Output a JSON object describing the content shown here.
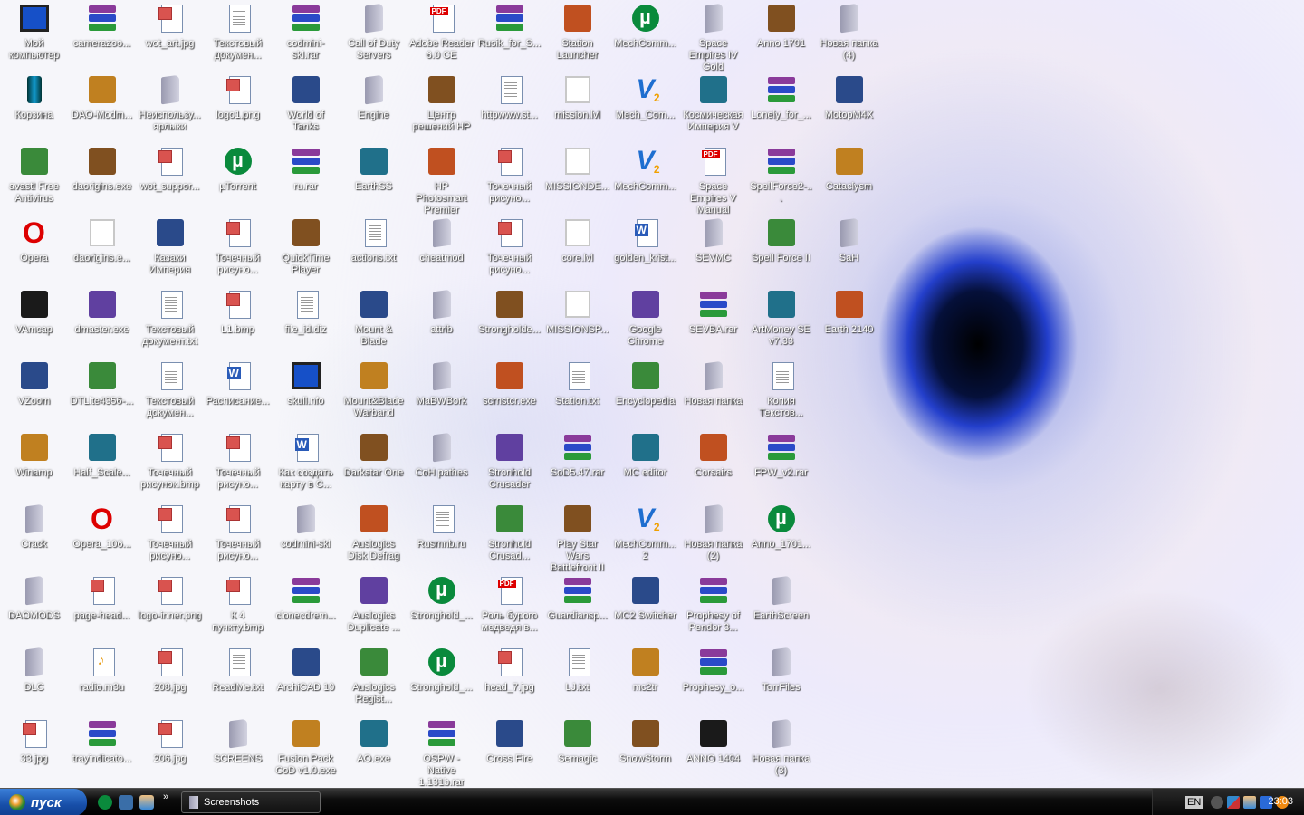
{
  "desktop": {
    "rows": [
      [
        [
          "Мой компьютер",
          "monitor"
        ],
        [
          "camerazoo...",
          "rar"
        ],
        [
          "wot_art.jpg",
          "img"
        ],
        [
          "Текстовый докумен...",
          "txt"
        ],
        [
          "codmini-skl.rar",
          "rar"
        ],
        [
          "Call of Duty Servers",
          "folder"
        ],
        [
          "Adobe Reader 6.0 CE",
          "pdf"
        ],
        [
          "Rusik_for_S...",
          "rar"
        ],
        [
          "Station Launcher",
          "app"
        ],
        [
          "MechComm...",
          "torrent"
        ],
        [
          "Space Empires IV Gold",
          "folder"
        ],
        [
          "Anno 1701",
          "app"
        ],
        [
          "Новая папка (4)",
          "folder"
        ]
      ],
      [
        [
          "Корзина",
          "recycle"
        ],
        [
          "DAO-Modm...",
          "app"
        ],
        [
          "Неиспользу... ярлыки",
          "folder"
        ],
        [
          "logo1.png",
          "img"
        ],
        [
          "World of Tanks",
          "app"
        ],
        [
          "Engine",
          "folder"
        ],
        [
          "Центр решений HP",
          "app"
        ],
        [
          "httpwww.st...",
          "txt"
        ],
        [
          "mission.lvl",
          "blank"
        ],
        [
          "Mech_Com...",
          "mech"
        ],
        [
          "Космическая Империя V",
          "app"
        ],
        [
          "Lonely_for_...",
          "rar"
        ],
        [
          "MotopM4X",
          "app"
        ]
      ],
      [
        [
          "avast! Free Antivirus",
          "app"
        ],
        [
          "daorigins.exe",
          "app"
        ],
        [
          "wot_suppor...",
          "img"
        ],
        [
          "µTorrent",
          "torrent"
        ],
        [
          "ru.rar",
          "rar"
        ],
        [
          "EarthSS",
          "app"
        ],
        [
          "HP Photosmart Premier",
          "app"
        ],
        [
          "Точечный рисуно...",
          "img"
        ],
        [
          "MISSIONDE...",
          "blank"
        ],
        [
          "MechComm...",
          "mech"
        ],
        [
          "Space Empires V Manual",
          "pdf"
        ],
        [
          "SpellForce2-...",
          "rar"
        ],
        [
          "Cataclysm",
          "app"
        ]
      ],
      [
        [
          "Opera",
          "opera"
        ],
        [
          "daorigins.e...",
          "blank"
        ],
        [
          "Казаки Империя",
          "app"
        ],
        [
          "Точечный рисуно...",
          "img"
        ],
        [
          "QuickTime Player",
          "app"
        ],
        [
          "actions.txt",
          "txt"
        ],
        [
          "cheatmod",
          "folder"
        ],
        [
          "Точечный рисуно...",
          "img"
        ],
        [
          "core.lvl",
          "blank"
        ],
        [
          "golden_krist...",
          "doc"
        ],
        [
          "SEVMC",
          "folder"
        ],
        [
          "Spell Force II",
          "app"
        ],
        [
          "SaH",
          "folder"
        ]
      ],
      [
        [
          "VAmcap",
          "app"
        ],
        [
          "dmaster.exe",
          "app"
        ],
        [
          "Текстовый документ.txt",
          "txt"
        ],
        [
          "L1.bmp",
          "img"
        ],
        [
          "file_id.diz",
          "txt"
        ],
        [
          "Mount & Blade",
          "app"
        ],
        [
          "attrib",
          "folder"
        ],
        [
          "Strongholde...",
          "app"
        ],
        [
          "MISSIONSP...",
          "blank"
        ],
        [
          "Google Chrome",
          "app"
        ],
        [
          "SEVBA.rar",
          "rar"
        ],
        [
          "ArtMoney SE v7.33",
          "app"
        ],
        [
          "Earth 2140",
          "app"
        ]
      ],
      [
        [
          "VZoom",
          "app"
        ],
        [
          "DTLite4356-...",
          "app"
        ],
        [
          "Текстовый докумен...",
          "txt"
        ],
        [
          "Расписание...",
          "doc"
        ],
        [
          "skull.nfo",
          "monitor"
        ],
        [
          "Mount&Blade Warband",
          "app"
        ],
        [
          "MaBWBork",
          "folder"
        ],
        [
          "scrnstcr.exe",
          "app"
        ],
        [
          "Station.txt",
          "txt"
        ],
        [
          "Encyclopedia",
          "app"
        ],
        [
          "Новая папка",
          "folder"
        ],
        [
          "Копия Текстов...",
          "txt"
        ]
      ],
      [
        [
          "Winamp",
          "app"
        ],
        [
          "Half_Scale...",
          "app"
        ],
        [
          "Точечный рисунок.bmp",
          "img"
        ],
        [
          "Точечный рисуно...",
          "img"
        ],
        [
          "Как создать карту в C...",
          "doc"
        ],
        [
          "Darkstar One",
          "app"
        ],
        [
          "CoH pathes",
          "folder"
        ],
        [
          "Stronhold Crusader",
          "app"
        ],
        [
          "SoD5.47.rar",
          "rar"
        ],
        [
          "MC editor",
          "app"
        ],
        [
          "Corsairs",
          "app"
        ],
        [
          "FPW_v2.rar",
          "rar"
        ]
      ],
      [
        [
          "Crack",
          "folder"
        ],
        [
          "Opera_106...",
          "opera"
        ],
        [
          "Точечный рисуно...",
          "img"
        ],
        [
          "Точечный рисуно...",
          "img"
        ],
        [
          "codmini-skl",
          "folder"
        ],
        [
          "Auslogics Disk Defrag",
          "app"
        ],
        [
          "Rusmnb.ru",
          "txt"
        ],
        [
          "Stronhold Crusad...",
          "app"
        ],
        [
          "Play Star Wars Battlefront II",
          "app"
        ],
        [
          "MechComm... 2",
          "mech"
        ],
        [
          "Новая папка (2)",
          "folder"
        ],
        [
          "Anno_1701...",
          "torrent"
        ]
      ],
      [
        [
          "DAOMODS",
          "folder"
        ],
        [
          "page-head...",
          "img"
        ],
        [
          "logo-inner.png",
          "img"
        ],
        [
          "К 4 пункту.bmp",
          "img"
        ],
        [
          "clonecdrem...",
          "rar"
        ],
        [
          "Auslogics Duplicate ...",
          "app"
        ],
        [
          "Stronghold_...",
          "torrent"
        ],
        [
          "Роль бурого медведя в...",
          "pdf"
        ],
        [
          "Guardiansp...",
          "rar"
        ],
        [
          "MC2 Switcher",
          "app"
        ],
        [
          "Prophesy of Pendor 3...",
          "rar"
        ],
        [
          "EarthScreen",
          "folder"
        ]
      ],
      [
        [
          "DLC",
          "folder"
        ],
        [
          "radio.m3u",
          "m3u"
        ],
        [
          "208.jpg",
          "img"
        ],
        [
          "ReadMe.txt",
          "txt"
        ],
        [
          "ArchiCAD 10",
          "app"
        ],
        [
          "Auslogics Regist...",
          "app"
        ],
        [
          "Stronghold_...",
          "torrent"
        ],
        [
          "head_7.jpg",
          "img"
        ],
        [
          "LJ.txt",
          "txt"
        ],
        [
          "mc2tr",
          "app"
        ],
        [
          "Prophesy_o...",
          "rar"
        ],
        [
          "TorrFiles",
          "folder"
        ]
      ],
      [
        [
          "33.jpg",
          "img"
        ],
        [
          "trayindicato...",
          "rar"
        ],
        [
          "206.jpg",
          "img"
        ],
        [
          "SCREENS",
          "folder"
        ],
        [
          "Fusion Pack CoD v1.0.exe",
          "app"
        ],
        [
          "AO.exe",
          "app"
        ],
        [
          "OSPW - Native 1.131b.rar",
          "rar"
        ],
        [
          "Cross Fire",
          "app"
        ],
        [
          "Semagic",
          "app"
        ],
        [
          "SnowStorm",
          "app"
        ],
        [
          "ANNO 1404",
          "app"
        ],
        [
          "Новая папка (3)",
          "folder"
        ]
      ]
    ]
  },
  "taskbar": {
    "start_label": "пуск",
    "quick_launch": [
      "utorrent-icon",
      "show-desktop-icon",
      "network-icon"
    ],
    "chevron": "»",
    "task_button": "Screenshots",
    "language": "EN",
    "clock": "23:03"
  },
  "colors": {
    "accent": "#1650c8",
    "taskbar": "#000000",
    "start": "#174ea8"
  }
}
